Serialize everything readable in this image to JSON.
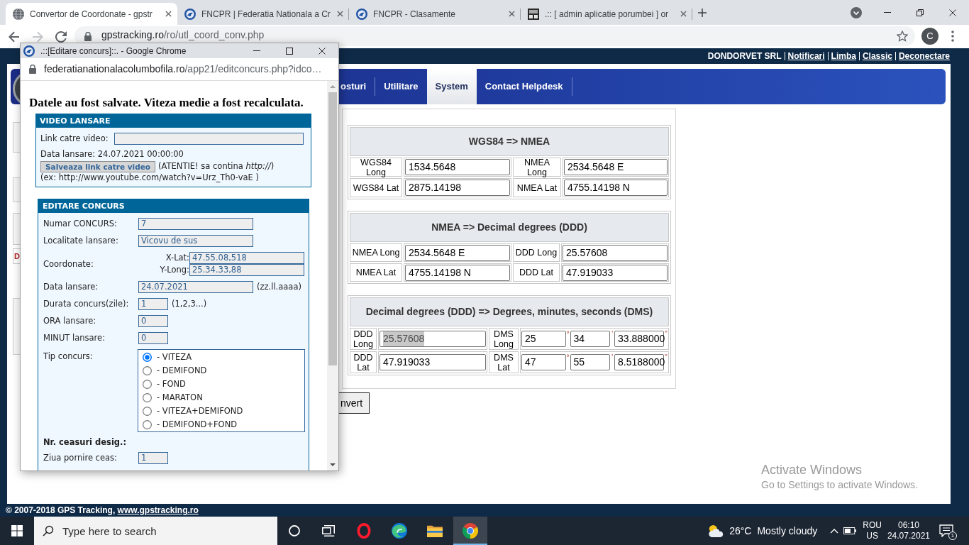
{
  "browser": {
    "tabs": [
      {
        "title": "Convertor de Coordonate - gpstr",
        "selected": true
      },
      {
        "title": "FNCPR | Federatia Nationala a Cr",
        "selected": false
      },
      {
        "title": "FNCPR - Clasamente",
        "selected": false
      },
      {
        "title": ".:: [ admin aplicatie porumbei ] or",
        "selected": false
      }
    ],
    "forward_disabled": true,
    "address": {
      "host": "gpstracking.ro",
      "path": "/ro/utl_coord_conv.php"
    },
    "profile_initial": "C"
  },
  "page": {
    "account": "DONDORVET SRL",
    "top_links": [
      "Notificari",
      "Limba",
      "Classic",
      "Deconectare"
    ],
    "menu": [
      {
        "label": "osturi",
        "selected": false
      },
      {
        "label": "Utilitare",
        "selected": false
      },
      {
        "label": "System",
        "selected": true
      },
      {
        "label": "Contact Helpdesk",
        "selected": false
      }
    ],
    "sidebar_text": "D",
    "converter": {
      "tables": [
        {
          "title": "WGS84 => NMEA",
          "rows": [
            {
              "cells": [
                {
                  "kind": "label",
                  "text": "WGS84 Long"
                },
                {
                  "kind": "input",
                  "value": "1534.5648",
                  "highlighted": false
                },
                {
                  "kind": "label",
                  "text": "NMEA Long"
                },
                {
                  "kind": "input",
                  "value": "2534.5648 E",
                  "highlighted": false
                }
              ]
            },
            {
              "cells": [
                {
                  "kind": "label",
                  "text": "WGS84 Lat"
                },
                {
                  "kind": "input",
                  "value": "2875.14198",
                  "highlighted": false
                },
                {
                  "kind": "label",
                  "text": "NMEA Lat"
                },
                {
                  "kind": "input",
                  "value": "4755.14198 N",
                  "highlighted": false
                }
              ]
            }
          ]
        },
        {
          "title": "NMEA => Decimal degrees (DDD)",
          "rows": [
            {
              "cells": [
                {
                  "kind": "label",
                  "text": "NMEA Long"
                },
                {
                  "kind": "input",
                  "value": "2534.5648 E",
                  "highlighted": false
                },
                {
                  "kind": "label",
                  "text": "DDD Long"
                },
                {
                  "kind": "input",
                  "value": "25.57608",
                  "highlighted": false
                }
              ]
            },
            {
              "cells": [
                {
                  "kind": "label",
                  "text": "NMEA Lat"
                },
                {
                  "kind": "input",
                  "value": "4755.14198 N",
                  "highlighted": false
                },
                {
                  "kind": "label",
                  "text": "DDD Lat"
                },
                {
                  "kind": "input",
                  "value": "47.919033",
                  "highlighted": false
                }
              ]
            }
          ]
        },
        {
          "title": "Decimal degrees (DDD) => Degrees, minutes, seconds (DMS)",
          "rows": [
            {
              "cells": [
                {
                  "kind": "label",
                  "text": "DDD Long"
                },
                {
                  "kind": "input",
                  "value": "25.57608",
                  "highlighted": true
                },
                {
                  "kind": "label",
                  "text": "DMS Long"
                },
                {
                  "kind": "dms",
                  "parts": [
                    {
                      "value": "25",
                      "unit": "°"
                    },
                    {
                      "value": "34",
                      "unit": "'"
                    },
                    {
                      "value": "33.888000",
                      "unit": "\""
                    }
                  ]
                }
              ]
            },
            {
              "cells": [
                {
                  "kind": "label",
                  "text": "DDD Lat"
                },
                {
                  "kind": "input",
                  "value": "47.919033",
                  "highlighted": false
                },
                {
                  "kind": "label",
                  "text": "DMS Lat"
                },
                {
                  "kind": "dms",
                  "parts": [
                    {
                      "value": "47",
                      "unit": "°"
                    },
                    {
                      "value": "55",
                      "unit": "'"
                    },
                    {
                      "value": "8.5188000",
                      "unit": "\""
                    }
                  ]
                }
              ]
            }
          ]
        }
      ]
    },
    "convert_button": "nvert",
    "footer": {
      "text": "© 2007-2018 GPS Tracking,",
      "link": "www.gpstracking.ro"
    }
  },
  "popup": {
    "title": ".::[Editare concurs]::. - Google Chrome",
    "address": {
      "host": "federatianationalacolumbofila.ro",
      "path": "/app21/editconcurs.php?idco…"
    },
    "message": "Datele au fost salvate. Viteza medie a fost recalculata.",
    "video": {
      "heading": "VIDEO LANSARE",
      "link_label": "Link catre video:",
      "launch_text": "Data lansare: 24.07.2021 00:00:00",
      "save_button": "Salveaza link catre video",
      "warning": "(ATENTIE! sa contina *http://*)",
      "example": "(ex: http://www.youtube.com/watch?v=Urz_Th0-vaE )"
    },
    "form": {
      "heading": "EDITARE CONCURS",
      "fields": [
        {
          "kind": "field",
          "label": "Numar CONCURS:",
          "value": "7"
        },
        {
          "kind": "field",
          "label": "Localitate lansare:",
          "value": "Vicovu de sus"
        },
        {
          "kind": "coords",
          "label": "Coordonate:",
          "parts": [
            {
              "label": "X-Lat:",
              "value": "47.55.08,518"
            },
            {
              "label": "Y-Long:",
              "value": "25.34.33,88"
            }
          ]
        },
        {
          "kind": "field",
          "label": "Data lansare:",
          "value": "24.07.2021",
          "note": "(zz.ll.aaaa)"
        },
        {
          "kind": "short_field",
          "label": "Durata concurs(zile):",
          "value": "1",
          "note": "(1,2,3...)"
        },
        {
          "kind": "short_field",
          "label": "ORA lansare:",
          "value": "0"
        },
        {
          "kind": "short_field",
          "label": "MINUT lansare:",
          "value": "0"
        },
        {
          "kind": "radio_group",
          "label": "Tip concurs:",
          "options": [
            {
              "label": "- VITEZA",
              "selected": true
            },
            {
              "label": "- DEMIFOND",
              "selected": false
            },
            {
              "label": "- FOND",
              "selected": false
            },
            {
              "label": "- MARATON",
              "selected": false
            },
            {
              "label": "- VITEZA+DEMIFOND",
              "selected": false
            },
            {
              "label": "- DEMIFOND+FOND",
              "selected": false
            }
          ]
        },
        {
          "kind": "section",
          "label": "Nr. ceasuri desig.:"
        },
        {
          "kind": "short_field",
          "label": "Ziua pornire ceas:",
          "value": "1"
        }
      ]
    }
  },
  "activation_notice": {
    "title": "Activate Windows",
    "text": "Go to Settings to activate Windows."
  },
  "taskbar": {
    "search_placeholder": "Type here to search",
    "apps": [
      {
        "kind": "assistant",
        "active": false
      },
      {
        "kind": "task_view",
        "active": false
      },
      {
        "kind": "ring_browser",
        "active": false
      },
      {
        "kind": "wave_browser",
        "active": false
      },
      {
        "kind": "files",
        "active": false
      },
      {
        "kind": "round_browser",
        "active": true
      }
    ],
    "weather": {
      "temperature": "26°C",
      "condition": "Mostly cloudy"
    },
    "language": "ROU",
    "keyboard": "US",
    "time": "06:10",
    "date": "24.07.2021",
    "notification_count": "1"
  }
}
